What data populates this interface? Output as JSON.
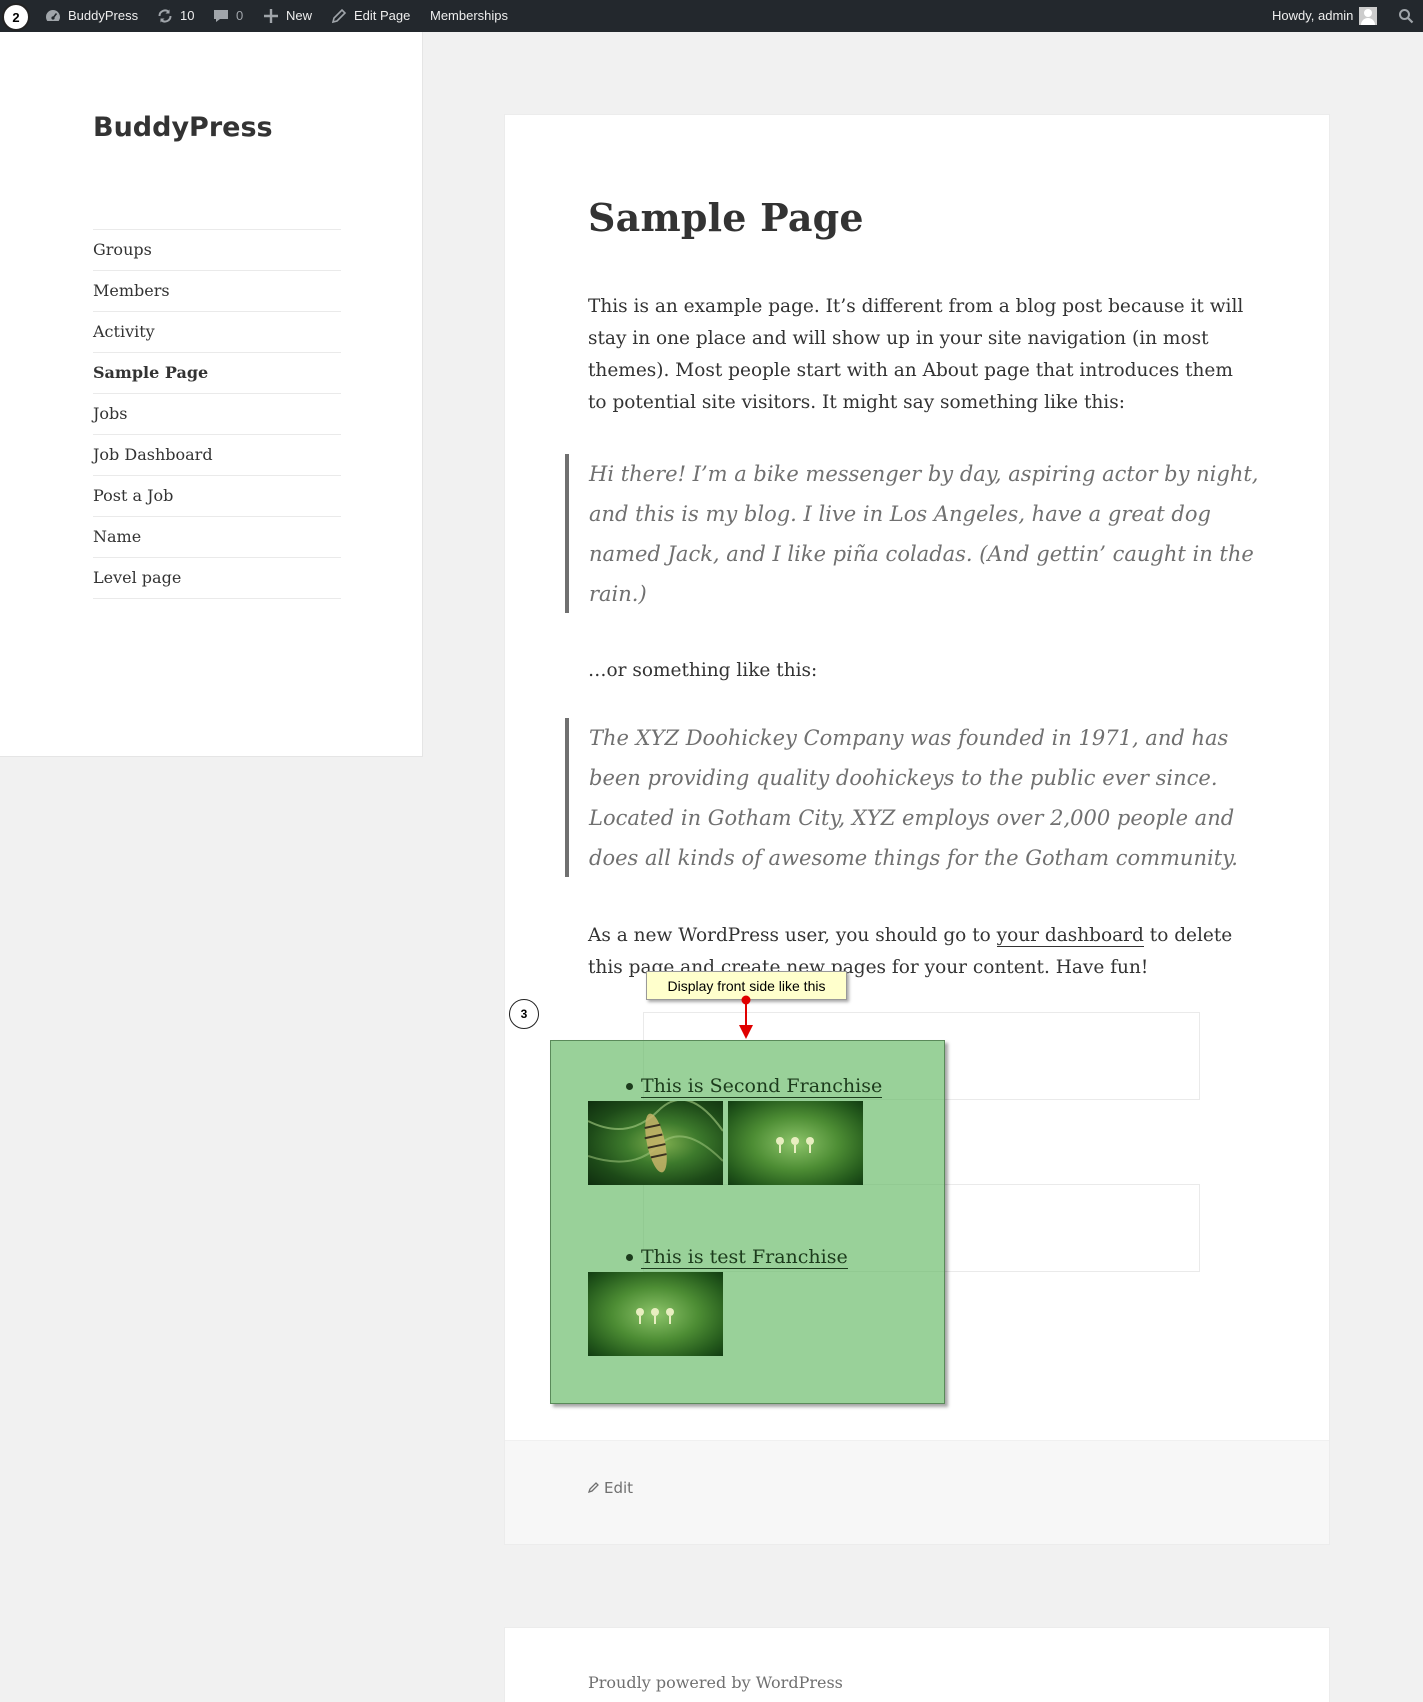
{
  "admin_bar": {
    "step_number": "2",
    "site_name": "BuddyPress",
    "updates_count": "10",
    "comments_count": "0",
    "new_label": "New",
    "edit_page_label": "Edit Page",
    "memberships_label": "Memberships",
    "greeting": "Howdy, admin"
  },
  "sidebar": {
    "site_title": "BuddyPress",
    "menu": [
      {
        "label": "Groups"
      },
      {
        "label": "Members"
      },
      {
        "label": "Activity"
      },
      {
        "label": "Sample Page",
        "current": true
      },
      {
        "label": "Jobs"
      },
      {
        "label": "Job Dashboard"
      },
      {
        "label": "Post a Job"
      },
      {
        "label": "Name"
      },
      {
        "label": "Level page"
      }
    ]
  },
  "article": {
    "title": "Sample Page",
    "intro": "This is an example page. It’s different from a blog post because it will stay in one place and will show up in your site navigation (in most themes). Most people start with an About page that introduces them to potential site visitors. It might say something like this:",
    "quote1": "Hi there! I’m a bike messenger by day, aspiring actor by night, and this is my blog. I live in Los Angeles, have a great dog named Jack, and I like piña coladas. (And gettin’ caught in the rain.)",
    "or_text": "…or something like this:",
    "quote2": "The XYZ Doohickey Company was founded in 1971, and has been providing quality doohickeys to the public ever since. Located in Gotham City, XYZ employs over 2,000 people and does all kinds of awesome things for the Gotham community.",
    "outro_before": "As a new WordPress user, you should go to ",
    "outro_link": "your dashboard",
    "outro_after": " to delete this page and create new pages for your content. Have fun!",
    "edit_label": "Edit"
  },
  "annotation": {
    "step_number": "3",
    "tooltip": "Display front side like this",
    "franchises": [
      {
        "title": "This is Second Franchise"
      },
      {
        "title": "This is test Franchise"
      }
    ]
  },
  "footer": {
    "powered_by": "Proudly powered by WordPress"
  },
  "colors": {
    "admin_bar_bg": "#23282d",
    "overlay_green": "#64b964",
    "tooltip_bg": "#ffffcc",
    "arrow_red": "#e00000"
  }
}
